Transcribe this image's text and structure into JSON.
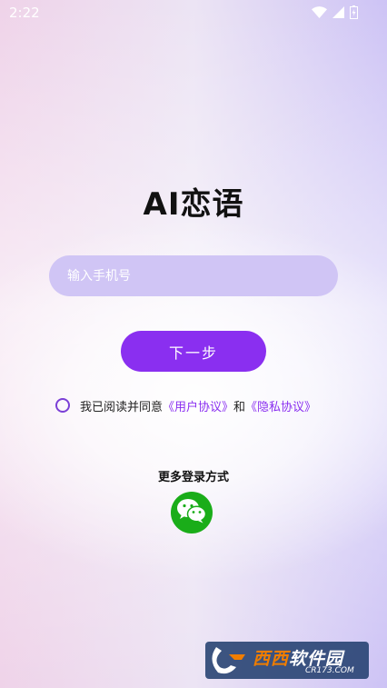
{
  "status_bar": {
    "time": "2:22",
    "icons": [
      "wifi-icon",
      "signal-icon",
      "battery-icon"
    ]
  },
  "app": {
    "title": "AI恋语"
  },
  "login": {
    "phone_placeholder": "输入手机号",
    "next_label": "下一步"
  },
  "agreement": {
    "checked": false,
    "text_prefix": "我已阅读并同意",
    "user_agreement": "《用户协议》",
    "conjunction": "和",
    "privacy_policy": "《隐私协议》"
  },
  "more_login": {
    "label": "更多登录方式",
    "methods": [
      "wechat-icon"
    ]
  },
  "colors": {
    "accent": "#8a2ff0",
    "input_bg": "#d0c5f5",
    "wechat": "#1aad19"
  },
  "watermark": {
    "brand_a": "西西",
    "brand_b": "软件园",
    "site": "CR173.COM"
  }
}
